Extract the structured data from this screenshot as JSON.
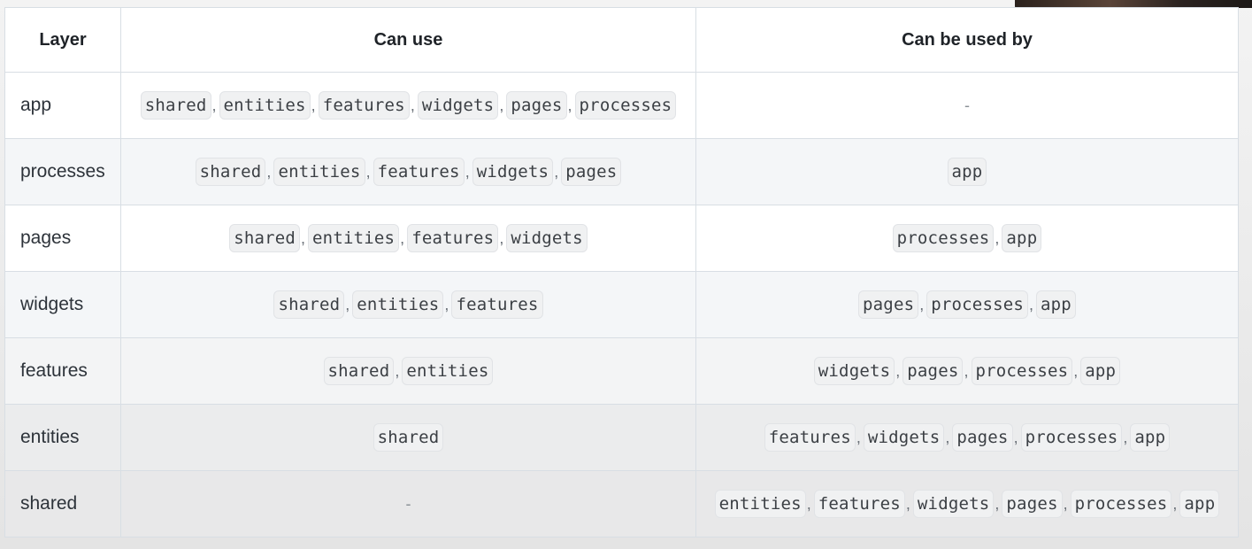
{
  "table": {
    "headers": [
      "Layer",
      "Can use",
      "Can be used by"
    ],
    "rows": [
      {
        "layer": "app",
        "can_use": [
          "shared",
          "entities",
          "features",
          "widgets",
          "pages",
          "processes"
        ],
        "can_be_used_by": [
          "-"
        ]
      },
      {
        "layer": "processes",
        "can_use": [
          "shared",
          "entities",
          "features",
          "widgets",
          "pages"
        ],
        "can_be_used_by": [
          "app"
        ]
      },
      {
        "layer": "pages",
        "can_use": [
          "shared",
          "entities",
          "features",
          "widgets"
        ],
        "can_be_used_by": [
          "processes",
          "app"
        ]
      },
      {
        "layer": "widgets",
        "can_use": [
          "shared",
          "entities",
          "features"
        ],
        "can_be_used_by": [
          "pages",
          "processes",
          "app"
        ]
      },
      {
        "layer": "features",
        "can_use": [
          "shared",
          "entities"
        ],
        "can_be_used_by": [
          "widgets",
          "pages",
          "processes",
          "app"
        ]
      },
      {
        "layer": "entities",
        "can_use": [
          "shared"
        ],
        "can_be_used_by": [
          "features",
          "widgets",
          "pages",
          "processes",
          "app"
        ]
      },
      {
        "layer": "shared",
        "can_use": [
          "-"
        ],
        "can_be_used_by": [
          "entities",
          "features",
          "widgets",
          "pages",
          "processes",
          "app"
        ]
      }
    ]
  },
  "separator": ","
}
